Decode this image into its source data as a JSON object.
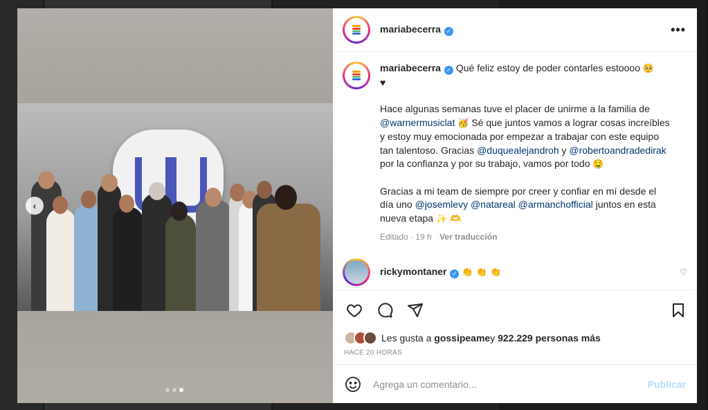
{
  "post": {
    "username": "mariabecerra",
    "verified_icon": "✓",
    "more_icon": "•••",
    "prev_icon": "‹"
  },
  "caption": {
    "username": "mariabecerra",
    "line1": "Qué feliz estoy de poder contarles estoooo",
    "line1_emoji": "🥺",
    "line1_heart": "♥",
    "p2_a": "Hace algunas semanas tuve el placer de unirme a la familia de ",
    "p2_mention1": "@warnermusiclat",
    "p2_emoji1": "🥳",
    "p2_b": " Sé que juntos vamos a lograr cosas increíbles y estoy muy emocionada por empezar a trabajar con este equipo tan talentoso. Gracias ",
    "p2_mention2": "@duquealejandroh",
    "p2_c": " y ",
    "p2_mention3": "@robertoandradedirak",
    "p2_d": " por la confianza y por su trabajo, vamos por todo ",
    "p2_emoji2": "🤤",
    "p3_a": "Gracias a mi team de siempre por creer y confiar en mí desde el día uno ",
    "p3_mention1": "@josemlevy",
    "p3_mention2": "@natareal",
    "p3_mention3": "@armanchofficial",
    "p3_b": " juntos en esta nueva etapa ",
    "p3_emoji": "✨ 🫶",
    "edited": "Editado · 19 h",
    "see_translation": "Ver traducción"
  },
  "comment": {
    "username": "rickymontaner",
    "text": "👏 👏 👏",
    "like_icon": "♡"
  },
  "likes": {
    "prefix": "Les gusta a ",
    "user": "gossipeame",
    "middle": " y ",
    "count": "922.229 personas más"
  },
  "timestamp": "HACE 20 HORAS",
  "add_comment": {
    "placeholder": "Agrega un comentario...",
    "publish": "Publicar"
  },
  "colors": {
    "accent": "#3897f0",
    "mention": "#00376b",
    "publish_disabled": "#b2dffc"
  }
}
